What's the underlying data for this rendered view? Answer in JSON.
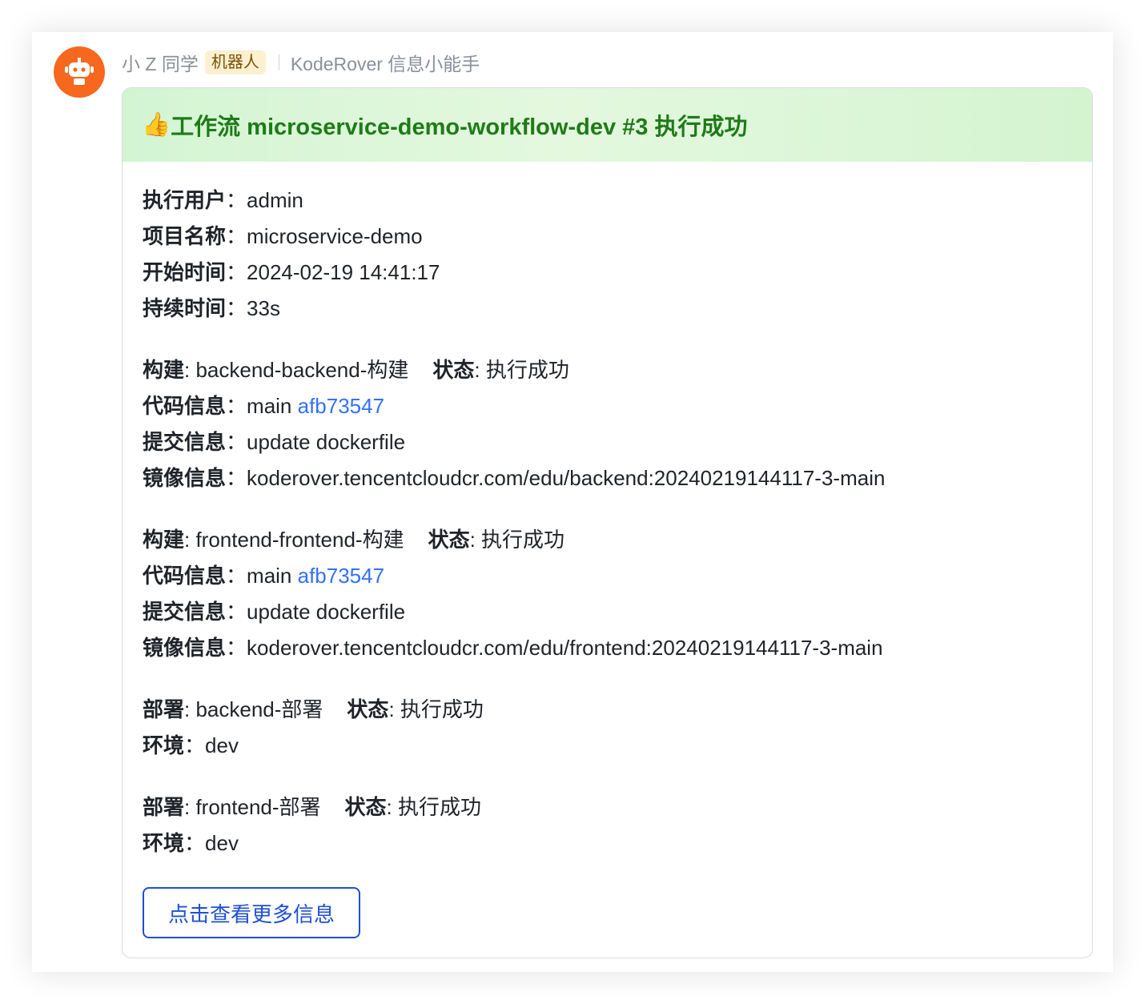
{
  "sender": {
    "name": "小 Z 同学",
    "badge": "机器人",
    "app_name": "KodeRover 信息小能手",
    "avatar_icon": "robot-icon",
    "avatar_color": "#f5681d"
  },
  "card": {
    "title_emoji": "👍",
    "title": "工作流 microservice-demo-workflow-dev #3 执行成功",
    "header_color": "#1f7b18",
    "summary": [
      {
        "label": "执行用户",
        "sep": "：",
        "value": "admin"
      },
      {
        "label": "项目名称",
        "sep": "：",
        "value": "microservice-demo"
      },
      {
        "label": "开始时间",
        "sep": "：",
        "value": "2024-02-19 14:41:17"
      },
      {
        "label": "持续时间",
        "sep": "：",
        "value": "33s"
      }
    ],
    "builds": [
      {
        "label": "构建",
        "name": ": backend-backend-构建",
        "status_label": "状态",
        "status": ": 执行成功",
        "code_label": "代码信息",
        "branch": "main ",
        "commit": "afb73547",
        "commit_label": "提交信息",
        "commit_msg": "update dockerfile",
        "image_label": "镜像信息",
        "image": "koderover.tencentcloudcr.com/edu/backend:20240219144117-3-main"
      },
      {
        "label": "构建",
        "name": ": frontend-frontend-构建",
        "status_label": "状态",
        "status": ": 执行成功",
        "code_label": "代码信息",
        "branch": "main ",
        "commit": "afb73547",
        "commit_label": "提交信息",
        "commit_msg": "update dockerfile",
        "image_label": "镜像信息",
        "image": "koderover.tencentcloudcr.com/edu/frontend:20240219144117-3-main"
      }
    ],
    "deploys": [
      {
        "label": "部署",
        "name": ": backend-部署",
        "status_label": "状态",
        "status": ": 执行成功",
        "env_label": "环境",
        "env": "dev"
      },
      {
        "label": "部署",
        "name": ": frontend-部署",
        "status_label": "状态",
        "status": ": 执行成功",
        "env_label": "环境",
        "env": "dev"
      }
    ],
    "field_sep": "：",
    "button_label": "点击查看更多信息",
    "link_color": "#3370ff",
    "button_color": "#1f4fd6"
  }
}
